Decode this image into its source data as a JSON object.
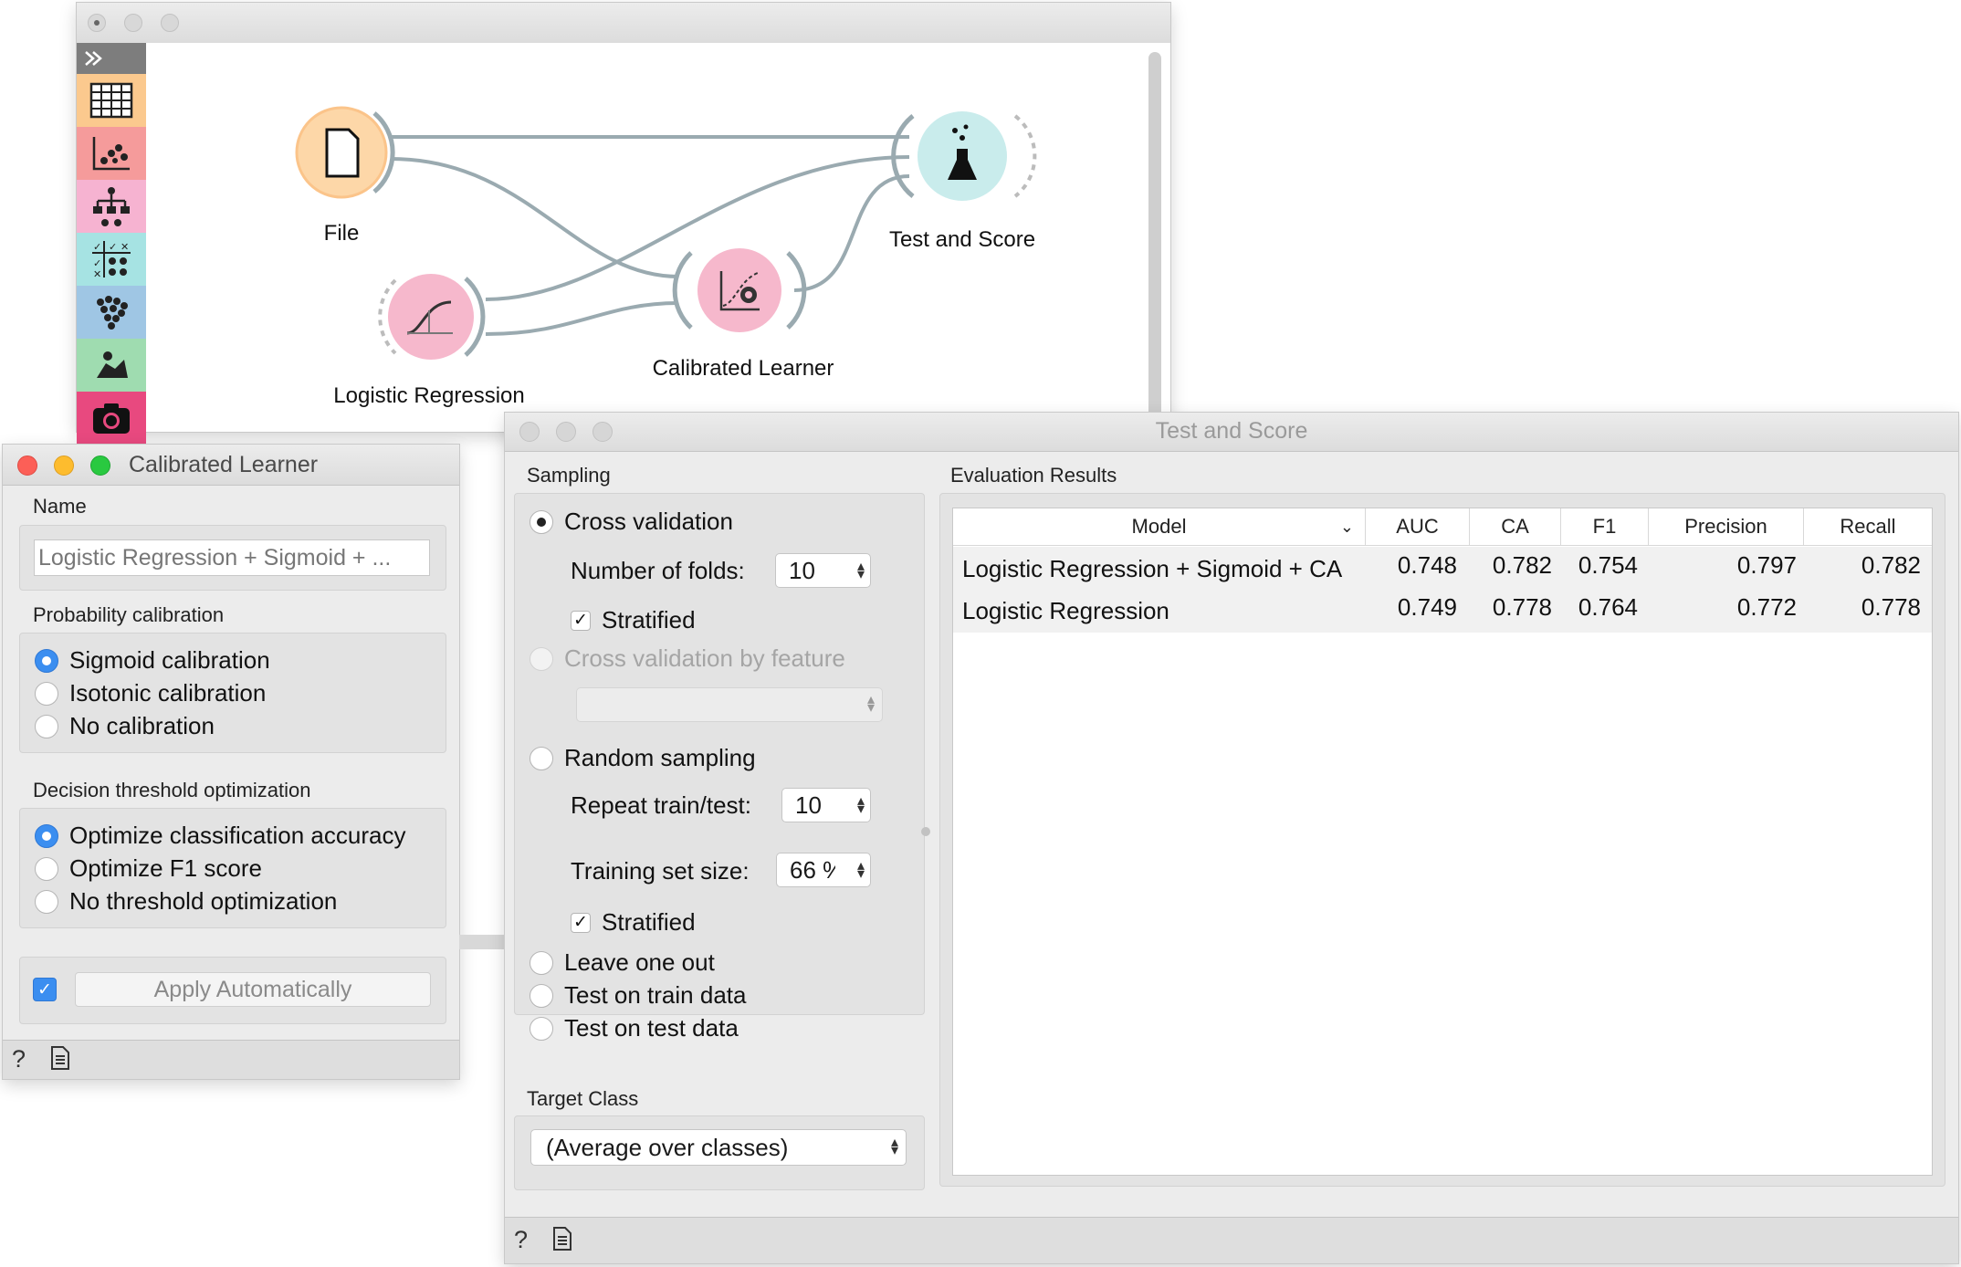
{
  "canvas": {
    "nodes": {
      "file": "File",
      "test_and_score": "Test and Score",
      "logistic_regression": "Logistic Regression",
      "calibrated_learner": "Calibrated Learner"
    },
    "toolbox_icons": [
      "collapse-icon",
      "data-table-icon",
      "scatter-plot-icon",
      "tree-icon",
      "confusion-matrix-icon",
      "clustering-icon",
      "mosaic-icon",
      "camera-icon"
    ]
  },
  "calibrated_learner": {
    "title": "Calibrated Learner",
    "name_label": "Name",
    "name_value": "Logistic Regression + Sigmoid + ...",
    "prob_label": "Probability calibration",
    "prob_options": [
      "Sigmoid calibration",
      "Isotonic calibration",
      "No calibration"
    ],
    "threshold_label": "Decision threshold optimization",
    "threshold_options": [
      "Optimize classification accuracy",
      "Optimize F1 score",
      "No threshold optimization"
    ],
    "apply_label": "Apply Automatically"
  },
  "test_and_score": {
    "title": "Test and Score",
    "sampling_label": "Sampling",
    "cross_validation": "Cross validation",
    "folds_label": "Number of folds:",
    "folds_value": "10",
    "stratified": "Stratified",
    "cv_by_feature": "Cross validation by feature",
    "random_sampling": "Random sampling",
    "repeat_label": "Repeat train/test:",
    "repeat_value": "10",
    "train_size_label": "Training set size:",
    "train_size_value": "66 %",
    "stratified2": "Stratified",
    "leave_one_out": "Leave one out",
    "test_on_train": "Test on train data",
    "test_on_test": "Test on test data",
    "target_class_label": "Target Class",
    "target_class_value": "(Average over classes)",
    "eval_label": "Evaluation Results",
    "columns": [
      "Model",
      "AUC",
      "CA",
      "F1",
      "Precision",
      "Recall"
    ],
    "rows": [
      {
        "model": "Logistic Regression + Sigmoid + CA",
        "auc": "0.748",
        "ca": "0.782",
        "f1": "0.754",
        "precision": "0.797",
        "recall": "0.782"
      },
      {
        "model": "Logistic Regression",
        "auc": "0.749",
        "ca": "0.778",
        "f1": "0.764",
        "precision": "0.772",
        "recall": "0.778"
      }
    ]
  },
  "colors": {
    "file_node": "#fdd7a8",
    "learner_node": "#f6b8cc",
    "test_node": "#c9ecec",
    "link": "#9aaab0",
    "radio_blue": "#3b8ef0"
  }
}
